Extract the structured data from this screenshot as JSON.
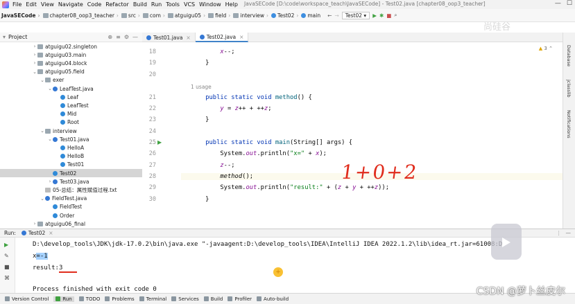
{
  "menubar": {
    "items": [
      "File",
      "Edit",
      "View",
      "Navigate",
      "Code",
      "Refactor",
      "Build",
      "Run",
      "Tools",
      "VCS",
      "Window",
      "Help"
    ],
    "window_title": "JavaSECode [D:\\code\\workspace_teach\\JavaSECode] - Test02.java [chapter08_oop3_teacher]"
  },
  "breadcrumbs": [
    "JavaSECode",
    "chapter08_oop3_teacher",
    "src",
    "com",
    "atguigu05",
    "field",
    "interview",
    "Test02",
    "main"
  ],
  "toolbar": {
    "run_config": "Test02"
  },
  "project_panel": {
    "title": "Project",
    "tree": [
      {
        "label": "atguigu02.singleton",
        "indent": 1,
        "icon": "pkg",
        "arrow": "›"
      },
      {
        "label": "atguigu03.main",
        "indent": 1,
        "icon": "pkg",
        "arrow": "›"
      },
      {
        "label": "atguigu04.block",
        "indent": 1,
        "icon": "pkg",
        "arrow": "›"
      },
      {
        "label": "atguigu05.field",
        "indent": 1,
        "icon": "pkg",
        "arrow": "⌄"
      },
      {
        "label": "exer",
        "indent": 2,
        "icon": "pkg",
        "arrow": "⌄"
      },
      {
        "label": "LeafTest.java",
        "indent": 3,
        "icon": "java",
        "arrow": "⌄"
      },
      {
        "label": "Leaf",
        "indent": 4,
        "icon": "cls",
        "arrow": ""
      },
      {
        "label": "LeafTest",
        "indent": 4,
        "icon": "cls",
        "arrow": ""
      },
      {
        "label": "Mid",
        "indent": 4,
        "icon": "cls",
        "arrow": ""
      },
      {
        "label": "Root",
        "indent": 4,
        "icon": "cls",
        "arrow": ""
      },
      {
        "label": "interview",
        "indent": 2,
        "icon": "pkg",
        "arrow": "⌄"
      },
      {
        "label": "Test01.java",
        "indent": 3,
        "icon": "java",
        "arrow": "⌄"
      },
      {
        "label": "HelloA",
        "indent": 4,
        "icon": "cls",
        "arrow": ""
      },
      {
        "label": "HelloB",
        "indent": 4,
        "icon": "cls",
        "arrow": ""
      },
      {
        "label": "Test01",
        "indent": 4,
        "icon": "cls",
        "arrow": ""
      },
      {
        "label": "Test02",
        "indent": 3,
        "icon": "cls",
        "arrow": "",
        "selected": true
      },
      {
        "label": "Test03.java",
        "indent": 3,
        "icon": "java",
        "arrow": "›"
      },
      {
        "label": "05-总结：属性赋值过程.txt",
        "indent": 2,
        "icon": "txt",
        "arrow": ""
      },
      {
        "label": "FieldTest.java",
        "indent": 2,
        "icon": "java",
        "arrow": "⌄"
      },
      {
        "label": "FieldTest",
        "indent": 3,
        "icon": "cls",
        "arrow": ""
      },
      {
        "label": "Order",
        "indent": 3,
        "icon": "cls",
        "arrow": ""
      },
      {
        "label": "atguigu06_final",
        "indent": 1,
        "icon": "pkg",
        "arrow": "›"
      }
    ]
  },
  "editor_tabs": [
    {
      "label": "Test01.java",
      "active": false
    },
    {
      "label": "Test02.java",
      "active": true
    }
  ],
  "editor": {
    "warning_count": "3",
    "usage_hint": "1 usage",
    "line_numbers": [
      "18",
      "19",
      "20",
      "21",
      "22",
      "23",
      "24",
      "25",
      "26",
      "27",
      "28",
      "29",
      "30"
    ],
    "handwritten_note": "1+0+2"
  },
  "run_panel": {
    "label": "Run:",
    "config": "Test02",
    "console": {
      "command": "D:\\develop_tools\\JDK\\jdk-17.0.2\\bin\\java.exe \"-javaagent:D:\\develop_tools\\IDEA\\IntelliJ IDEA 2022.1.2\\lib\\idea_rt.jar=61008:D",
      "line_x_prefix": "x",
      "line_x_selected": "=-1",
      "line_result_prefix": "result:",
      "line_result_value": "3",
      "exit_line": "Process finished with exit code 0"
    }
  },
  "right_stripe": [
    "Database",
    "jclasslib",
    "Notifications"
  ],
  "bottom_tabs": [
    "Version Control",
    "Run",
    "TODO",
    "Problems",
    "Terminal",
    "Services",
    "Build",
    "Profiler",
    "Auto-build"
  ],
  "watermark": "CSDN @萝卜丝皮尔",
  "top_watermark": "尚硅谷"
}
